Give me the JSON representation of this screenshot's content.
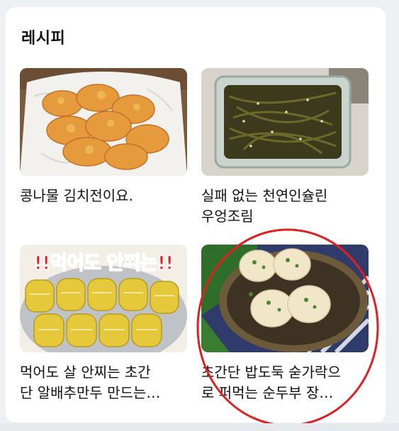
{
  "section": {
    "title": "레시피"
  },
  "recipes": [
    {
      "caption": "콩나물 김치전이요.",
      "image": "kimchi-pancake-photo"
    },
    {
      "caption_line1": "실패 없는 천연인슐린",
      "caption_line2": "우엉조림",
      "image": "burdock-root-photo"
    },
    {
      "caption_line1": "먹어도 살 안찌는 초간",
      "caption_line2": "단 알배추만두 만드는…",
      "image": "napa-cabbage-dumpling-photo",
      "overlay_text": "!!먹어도 안찌는!!"
    },
    {
      "caption_line1": "초간단 밥도둑 숟가락으",
      "caption_line2": "로 퍼먹는 순두부 장…",
      "image": "soft-tofu-photo"
    }
  ],
  "colors": {
    "annotation": "#e02020",
    "card": "#ffffff",
    "background": "#eef1f4"
  }
}
